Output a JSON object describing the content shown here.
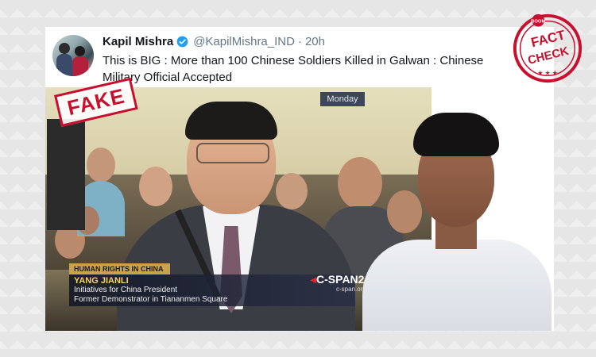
{
  "tweet": {
    "author_name": "Kapil Mishra",
    "handle": "@KapilMishra_IND",
    "separator": "·",
    "time": "20h",
    "text": "This is BIG : More than 100 Chinese Soldiers Killed in Galwan :  Chinese Military Official Accepted"
  },
  "video": {
    "day_label": "Monday",
    "lower_third": {
      "tag": "HUMAN RIGHTS IN CHINA",
      "name": "YANG JIANLI",
      "line1": "Initiatives for China President",
      "line2": "Former Demonstrator in Tiananmen Square"
    },
    "network": "C-SPAN2",
    "network_url": "c-span.org"
  },
  "stamps": {
    "fake": "FAKE",
    "fact_check_top": "FACT",
    "fact_check_bottom": "CHECK",
    "fact_check_brand": "BOOM"
  },
  "colors": {
    "stamp_red": "#c8102e",
    "verified_blue": "#1da1f2",
    "lower_third_gold": "#c9a24a"
  }
}
